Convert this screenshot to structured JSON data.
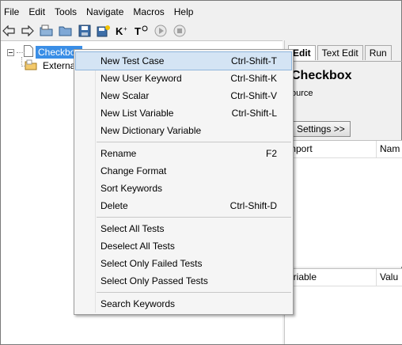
{
  "menubar": {
    "items": [
      "File",
      "Edit",
      "Tools",
      "Navigate",
      "Macros",
      "Help"
    ]
  },
  "toolbar": {
    "icons": [
      "back-arrow-icon",
      "forward-arrow-icon",
      "open-folder-icon",
      "open-directory-icon",
      "save-icon",
      "save-all-icon",
      "keyword-search-icon",
      "test-search-icon",
      "run-icon",
      "stop-icon"
    ]
  },
  "tree": {
    "root_label": "Checkbox",
    "child_label": "External"
  },
  "editor": {
    "tabs": [
      "Edit",
      "Text Edit",
      "Run"
    ],
    "suite_title": "Checkbox",
    "source_label": "ource",
    "settings_button": "Settings >>",
    "import_header": [
      "mport",
      "Nam"
    ],
    "variable_header": [
      "ariable",
      "Valu"
    ]
  },
  "context_menu": {
    "groups": [
      [
        {
          "label": "New Test Case",
          "shortcut": "Ctrl-Shift-T"
        },
        {
          "label": "New User Keyword",
          "shortcut": "Ctrl-Shift-K"
        },
        {
          "label": "New Scalar",
          "shortcut": "Ctrl-Shift-V"
        },
        {
          "label": "New List Variable",
          "shortcut": "Ctrl-Shift-L"
        },
        {
          "label": "New Dictionary Variable",
          "shortcut": ""
        }
      ],
      [
        {
          "label": "Rename",
          "shortcut": "F2"
        },
        {
          "label": "Change Format",
          "shortcut": ""
        },
        {
          "label": "Sort Keywords",
          "shortcut": ""
        },
        {
          "label": "Delete",
          "shortcut": "Ctrl-Shift-D"
        }
      ],
      [
        {
          "label": "Select All Tests",
          "shortcut": ""
        },
        {
          "label": "Deselect All Tests",
          "shortcut": ""
        },
        {
          "label": "Select Only Failed Tests",
          "shortcut": ""
        },
        {
          "label": "Select Only Passed Tests",
          "shortcut": ""
        }
      ],
      [
        {
          "label": "Search Keywords",
          "shortcut": ""
        }
      ]
    ]
  },
  "colors": {
    "selection": "#3a8ee6",
    "menu_highlight": "#d4e4f4"
  }
}
